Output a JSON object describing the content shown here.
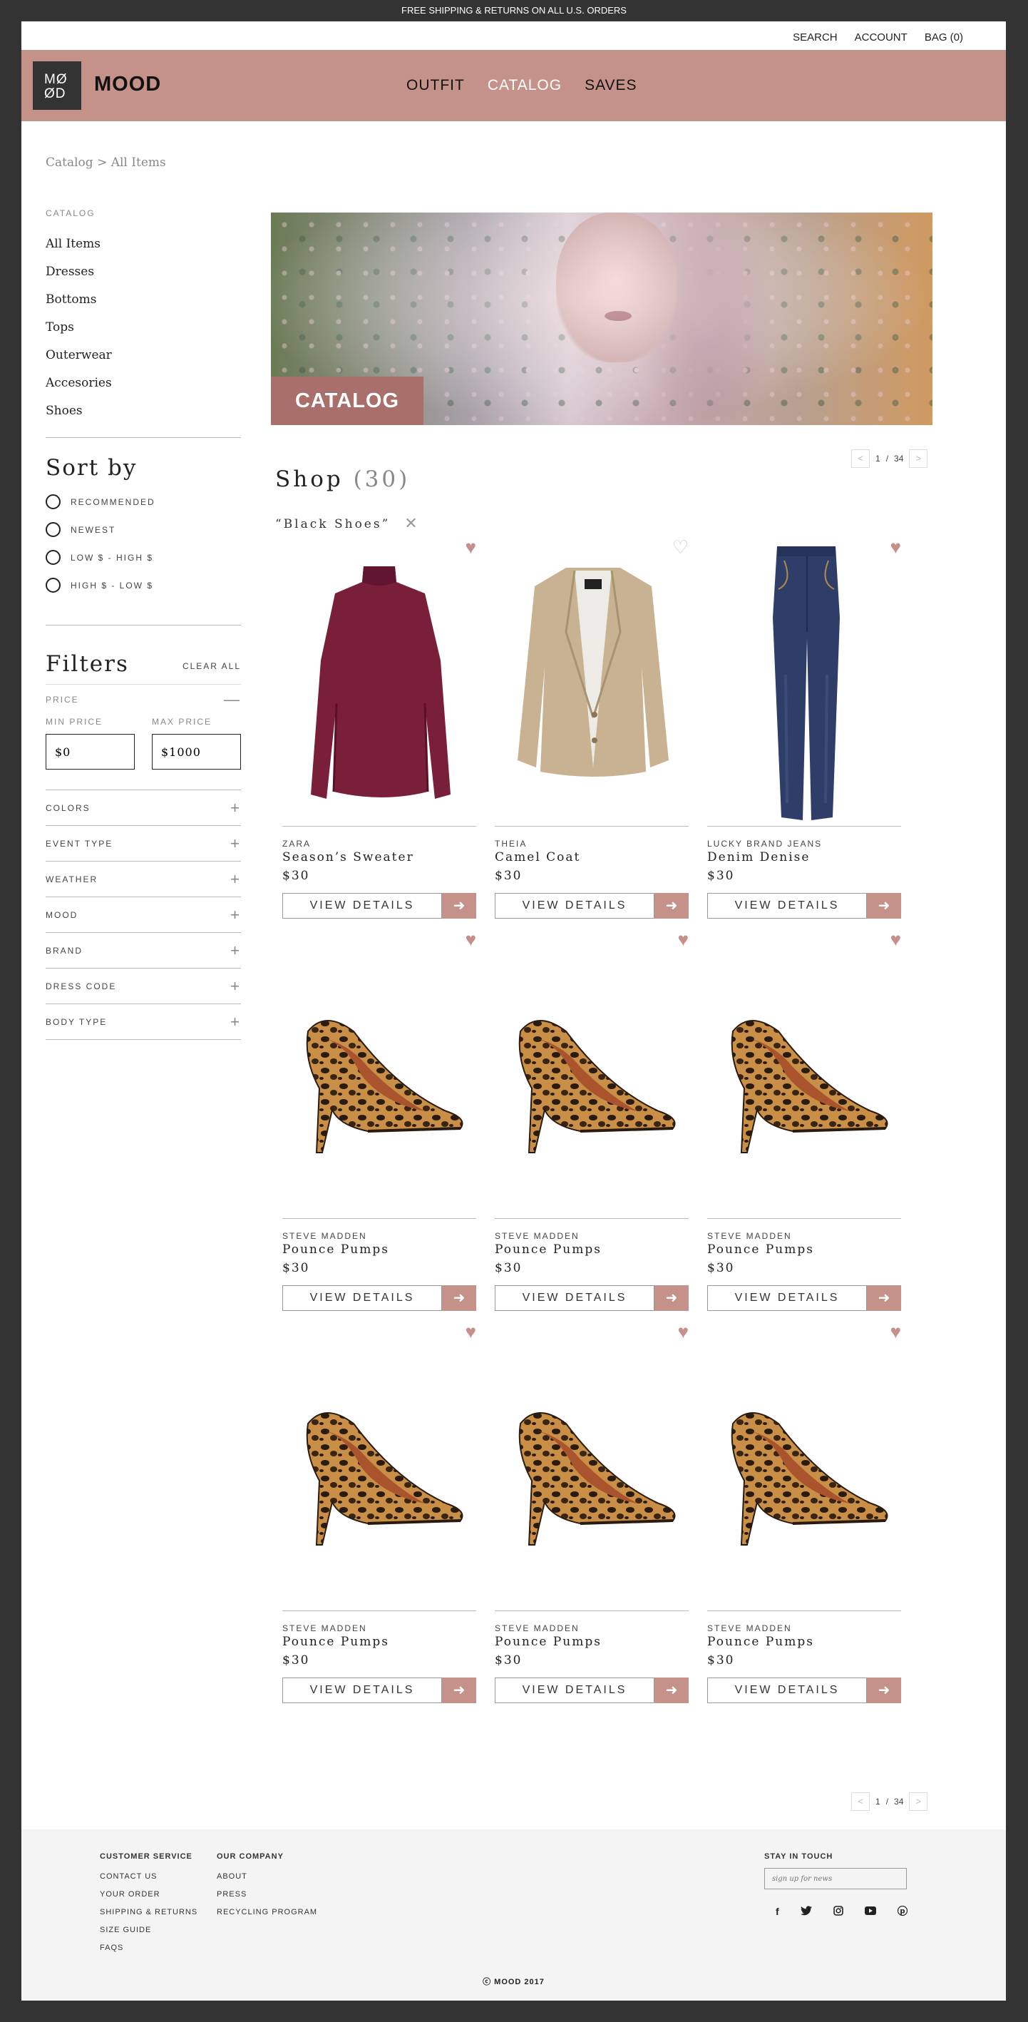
{
  "topbar": {
    "promo": "FREE SHIPPING & RETURNS ON ALL U.S. ORDERS"
  },
  "util": {
    "search": "SEARCH",
    "account": "ACCOUNT",
    "bag": "BAG (0)"
  },
  "header": {
    "logo_line1": "MØ",
    "logo_line2": "ØD",
    "brand": "MOOD",
    "nav": [
      "OUTFIT",
      "CATALOG",
      "SAVES"
    ],
    "active_nav": "CATALOG"
  },
  "breadcrumb": "Catalog > All Items",
  "sidebar": {
    "catalog_title": "CATALOG",
    "categories": [
      "All Items",
      "Dresses",
      "Bottoms",
      "Tops",
      "Outerwear",
      "Accesories",
      "Shoes"
    ],
    "sort_title": "Sort by",
    "sort_options": [
      "RECOMMENDED",
      "NEWEST",
      "LOW $ - HIGH $",
      "HIGH $ - LOW $"
    ],
    "filters_title": "Filters",
    "clear_all": "CLEAR ALL",
    "price_label": "PRICE",
    "min_label": "MIN PRICE",
    "max_label": "MAX PRICE",
    "min_value": "$0",
    "max_value": "$1000",
    "facets": [
      "COLORS",
      "EVENT TYPE",
      "WEATHER",
      "MOOD",
      "BRAND",
      "DRESS CODE",
      "BODY TYPE"
    ]
  },
  "hero": {
    "label": "CATALOG"
  },
  "shop": {
    "title": "Shop",
    "count": "(30)",
    "tag": "“Black Shoes”"
  },
  "pager": {
    "prev": "<",
    "page": "1",
    "sep": "/",
    "total": "34",
    "next": ">"
  },
  "products": [
    {
      "brand": "ZARA",
      "name": "Season’s Sweater",
      "price": "$30",
      "saved": true,
      "image": "sweater"
    },
    {
      "brand": "THEIA",
      "name": "Camel Coat",
      "price": "$30",
      "saved": false,
      "image": "coat"
    },
    {
      "brand": "LUCKY BRAND JEANS",
      "name": "Denim Denise",
      "price": "$30",
      "saved": true,
      "image": "jeans"
    },
    {
      "brand": "STEVE MADDEN",
      "name": "Pounce Pumps",
      "price": "$30",
      "saved": true,
      "image": "pump"
    },
    {
      "brand": "STEVE MADDEN",
      "name": "Pounce Pumps",
      "price": "$30",
      "saved": true,
      "image": "pump"
    },
    {
      "brand": "STEVE MADDEN",
      "name": "Pounce Pumps",
      "price": "$30",
      "saved": true,
      "image": "pump"
    },
    {
      "brand": "STEVE MADDEN",
      "name": "Pounce Pumps",
      "price": "$30",
      "saved": true,
      "image": "pump"
    },
    {
      "brand": "STEVE MADDEN",
      "name": "Pounce Pumps",
      "price": "$30",
      "saved": true,
      "image": "pump"
    },
    {
      "brand": "STEVE MADDEN",
      "name": "Pounce Pumps",
      "price": "$30",
      "saved": true,
      "image": "pump"
    }
  ],
  "view_details": "VIEW DETAILS",
  "footer": {
    "customer_title": "CUSTOMER SERVICE",
    "customer_links": [
      "CONTACT US",
      "YOUR ORDER",
      "SHIPPING & RETURNS",
      "SIZE GUIDE",
      "FAQS"
    ],
    "company_title": "OUR COMPANY",
    "company_links": [
      "ABOUT",
      "PRESS",
      "RECYCLING PROGRAM"
    ],
    "touch_title": "STAY IN TOUCH",
    "signup_placeholder": "sign up for news",
    "social": [
      "facebook-icon",
      "twitter-icon",
      "instagram-icon",
      "youtube-icon",
      "pinterest-icon"
    ],
    "copyright": "MOOD 2017"
  },
  "colors": {
    "accent": "#c59289",
    "accent_dark": "#a86f6b",
    "frame": "#333333"
  }
}
